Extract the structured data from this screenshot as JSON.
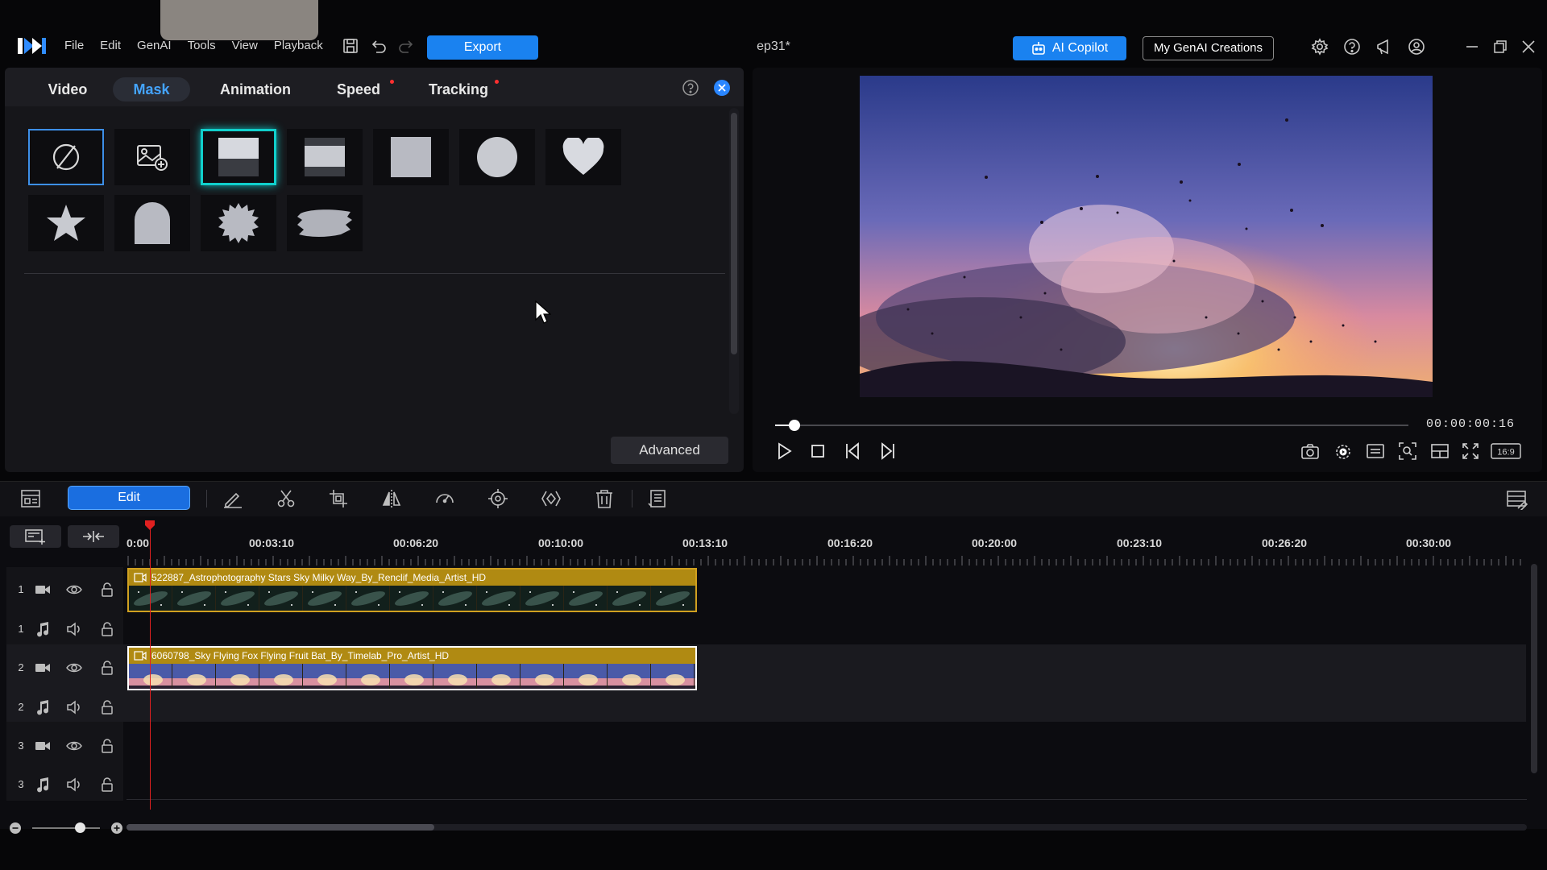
{
  "app": {
    "project_title": "ep31*",
    "menu": [
      "File",
      "Edit",
      "GenAI",
      "Tools",
      "View",
      "Playback"
    ],
    "export_label": "Export",
    "ai_copilot_label": "AI Copilot",
    "genai_creations_label": "My GenAI Creations"
  },
  "mask_panel": {
    "tabs": [
      {
        "label": "Video",
        "active": false,
        "dot": false
      },
      {
        "label": "Mask",
        "active": true,
        "dot": false
      },
      {
        "label": "Animation",
        "active": false,
        "dot": false
      },
      {
        "label": "Speed",
        "active": false,
        "dot": true
      },
      {
        "label": "Tracking",
        "active": false,
        "dot": true
      }
    ],
    "advanced_label": "Advanced",
    "selected_mask": "gradient-top"
  },
  "preview": {
    "timecode": "00:00:00:16",
    "aspect_ratio": "16:9",
    "progress_fraction": 0.03
  },
  "toolbar": {
    "edit_label": "Edit"
  },
  "timeline": {
    "ruler_labels": [
      "0:00",
      "00:03:10",
      "00:06:20",
      "00:10:00",
      "00:13:10",
      "00:16:20",
      "00:20:00",
      "00:23:10",
      "00:26:20",
      "00:30:00"
    ],
    "tracks": [
      {
        "num": "1",
        "kind": "video"
      },
      {
        "num": "1",
        "kind": "audio"
      },
      {
        "num": "2",
        "kind": "video"
      },
      {
        "num": "2",
        "kind": "audio"
      },
      {
        "num": "3",
        "kind": "video"
      },
      {
        "num": "3",
        "kind": "audio"
      }
    ],
    "clips": [
      {
        "track": "1",
        "name": "522887_Astrophotography Stars Sky Milky Way_By_Renclif_Media_Artist_HD"
      },
      {
        "track": "2",
        "name": "6060798_Sky Flying Fox Flying Fruit Bat_By_Timelab_Pro_Artist_HD"
      }
    ]
  },
  "colors": {
    "accent": "#1a82f0",
    "mask_active_tab": "#44a4ff",
    "clip_label": "#b08a12",
    "playhead": "#e02020"
  }
}
